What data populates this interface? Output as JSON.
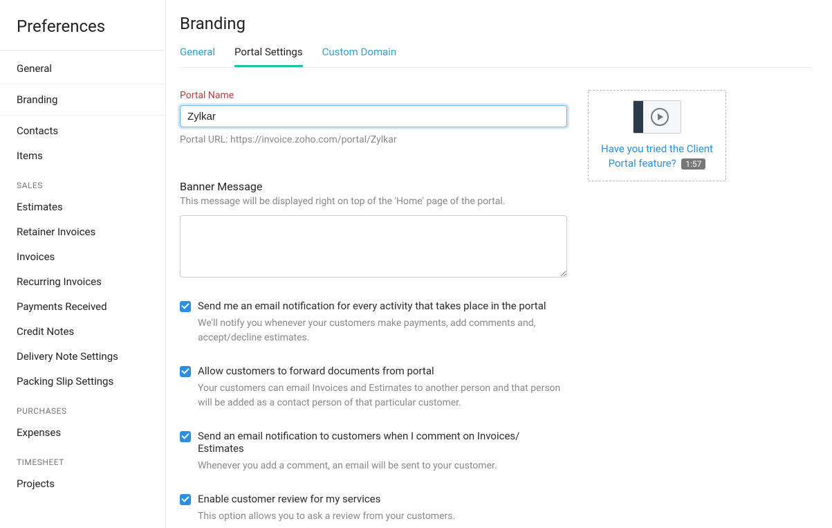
{
  "sidebar": {
    "title": "Preferences",
    "groups": [
      {
        "label": null,
        "items": [
          {
            "label": "General",
            "active": false
          },
          {
            "label": "Branding",
            "active": true
          },
          {
            "label": "Contacts",
            "active": false
          },
          {
            "label": "Items",
            "active": false
          }
        ]
      },
      {
        "label": "SALES",
        "items": [
          {
            "label": "Estimates"
          },
          {
            "label": "Retainer Invoices"
          },
          {
            "label": "Invoices"
          },
          {
            "label": "Recurring Invoices"
          },
          {
            "label": "Payments Received"
          },
          {
            "label": "Credit Notes"
          },
          {
            "label": "Delivery Note Settings"
          },
          {
            "label": "Packing Slip Settings"
          }
        ]
      },
      {
        "label": "PURCHASES",
        "items": [
          {
            "label": "Expenses"
          }
        ]
      },
      {
        "label": "TIMESHEET",
        "items": [
          {
            "label": "Projects"
          }
        ]
      }
    ]
  },
  "page": {
    "title": "Branding"
  },
  "tabs": [
    {
      "label": "General",
      "active": false
    },
    {
      "label": "Portal Settings",
      "active": true
    },
    {
      "label": "Custom Domain",
      "active": false
    }
  ],
  "portal": {
    "name_label": "Portal Name",
    "name_value": "Zylkar",
    "url_label": "Portal URL: https://invoice.zoho.com/portal/Zylkar"
  },
  "banner": {
    "label": "Banner Message",
    "hint": "This message will be displayed right on top of the 'Home' page of the portal.",
    "value": ""
  },
  "options": [
    {
      "checked": true,
      "label": "Send me an email notification for every activity that takes place in the portal",
      "hint": "We'll notify you whenever your customers make payments, add comments and, accept/decline estimates."
    },
    {
      "checked": true,
      "label": "Allow customers to forward documents from portal",
      "hint": "Your customers can email Invoices and Estimates to another person and that person will be added as a contact person of that particular customer."
    },
    {
      "checked": true,
      "label": "Send an email notification to customers when I comment on Invoices/ Estimates",
      "hint": "Whenever you add a comment, an email will be sent to your customer."
    },
    {
      "checked": true,
      "label": "Enable customer review for my services",
      "hint": "This option allows you to ask a review from your customers."
    }
  ],
  "promo": {
    "text": "Have you tried the Client Portal feature?",
    "duration": "1:57"
  }
}
